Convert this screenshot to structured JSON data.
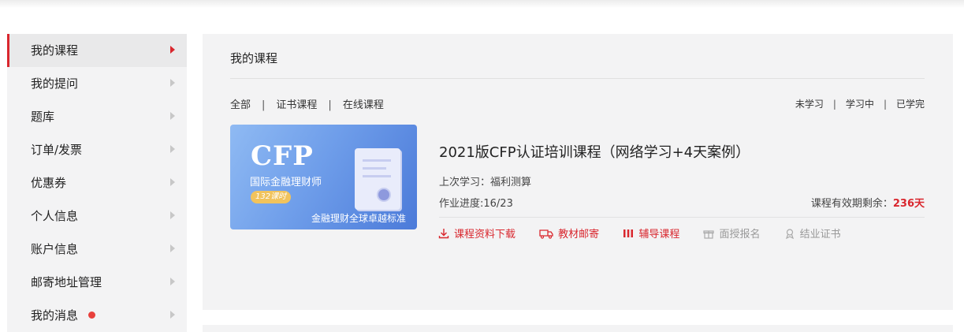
{
  "sidebar": {
    "items": [
      {
        "label": "我的课程",
        "active": true
      },
      {
        "label": "我的提问"
      },
      {
        "label": "题库"
      },
      {
        "label": "订单/发票"
      },
      {
        "label": "优惠券"
      },
      {
        "label": "个人信息"
      },
      {
        "label": "账户信息"
      },
      {
        "label": "邮寄地址管理"
      },
      {
        "label": "我的消息",
        "unread_dot": true
      }
    ]
  },
  "main": {
    "title": "我的课程",
    "filters_left": [
      "全部",
      "证书课程",
      "在线课程"
    ],
    "filters_right": [
      "未学习",
      "学习中",
      "已学完"
    ],
    "course": {
      "thumbnail": {
        "brand": "CFP",
        "subtitle": "国际金融理财师",
        "badge": "132课时",
        "tagline": "金融理财全球卓越标准"
      },
      "title": "2021版CFP认证培训课程（网络学习+4天案例）",
      "last_study": "上次学习：福利测算",
      "homework_progress": "作业进度:16/23",
      "validity_label": "课程有效期剩余：",
      "validity_days": "236天",
      "actions": [
        {
          "label": "课程资料下载",
          "icon": "download-icon",
          "enabled": true
        },
        {
          "label": "教材邮寄",
          "icon": "truck-icon",
          "enabled": true
        },
        {
          "label": "辅导课程",
          "icon": "bars-icon",
          "enabled": true
        },
        {
          "label": "面授报名",
          "icon": "gift-icon",
          "enabled": false
        },
        {
          "label": "结业证书",
          "icon": "certificate-icon",
          "enabled": false
        }
      ]
    }
  },
  "colors": {
    "accent": "#d9272e",
    "panel_bg": "#f3f3f4",
    "disabled": "#999999"
  }
}
